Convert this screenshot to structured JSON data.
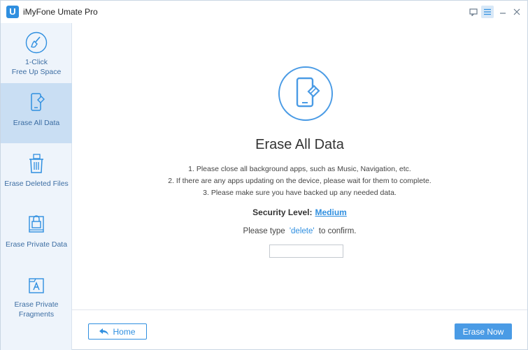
{
  "app": {
    "title": "iMyFone Umate Pro",
    "logo_letter": "U"
  },
  "titlebar": {
    "feedback_icon": "feedback-icon",
    "menu_icon": "menu-icon"
  },
  "sidebar": {
    "items": [
      {
        "id": "free-up-space",
        "label_line1": "1-Click",
        "label_line2": "Free Up Space",
        "icon": "broom-icon",
        "selected": false
      },
      {
        "id": "erase-all-data",
        "label_line1": "Erase All Data",
        "label_line2": "",
        "icon": "phone-eraser-icon",
        "selected": true
      },
      {
        "id": "erase-deleted-files",
        "label_line1": "Erase Deleted Files",
        "label_line2": "",
        "icon": "trash-icon",
        "selected": false
      },
      {
        "id": "erase-private-data",
        "label_line1": "Erase Private Data",
        "label_line2": "",
        "icon": "locked-files-icon",
        "selected": false
      },
      {
        "id": "erase-private-fragments",
        "label_line1": "Erase Private",
        "label_line2": "Fragments",
        "icon": "fragments-icon",
        "selected": false
      }
    ]
  },
  "main": {
    "title": "Erase All Data",
    "instructions": [
      "1. Please close all background apps, such as Music, Navigation, etc.",
      "2. If there are any apps updating on the device, please wait for them to complete.",
      "3. Please make sure you have backed up any needed data."
    ],
    "security_label": "Security Level:",
    "security_value": "Medium",
    "confirm_prefix": "Please type",
    "confirm_keyword": "'delete'",
    "confirm_suffix": "to confirm.",
    "confirm_input_value": ""
  },
  "footer": {
    "home_label": "Home",
    "erase_label": "Erase Now"
  },
  "colors": {
    "accent": "#2f8fe0",
    "sidebar_bg": "#eef4fb",
    "sidebar_selected": "#c9def3",
    "button_primary": "#4a9be5"
  }
}
